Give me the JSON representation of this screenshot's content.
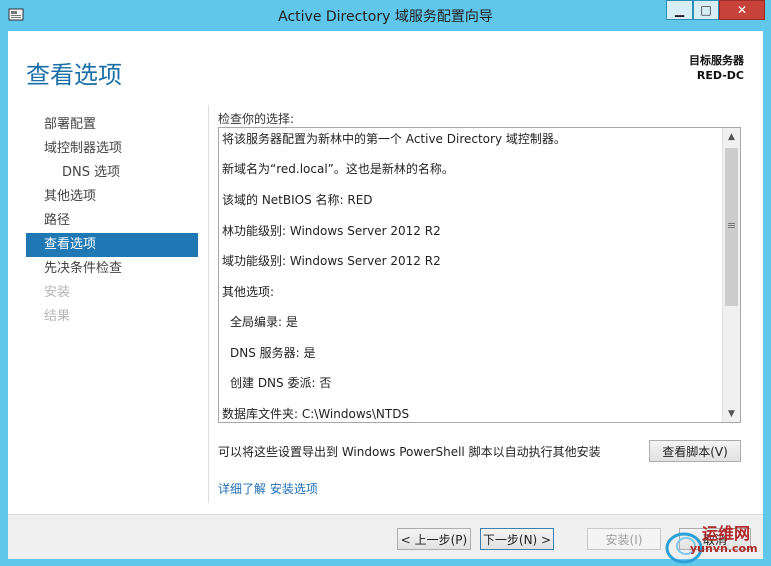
{
  "window": {
    "title": "Active Directory 域服务配置向导",
    "min_glyph": "▁",
    "max_glyph": "□",
    "close_glyph": "✕"
  },
  "header": {
    "page_title": "查看选项",
    "target_label": "目标服务器",
    "target_name": "RED-DC"
  },
  "nav": {
    "items": [
      {
        "label": "部署配置",
        "state": "normal"
      },
      {
        "label": "域控制器选项",
        "state": "normal"
      },
      {
        "label": "DNS 选项",
        "state": "sub"
      },
      {
        "label": "其他选项",
        "state": "normal"
      },
      {
        "label": "路径",
        "state": "normal"
      },
      {
        "label": "查看选项",
        "state": "active"
      },
      {
        "label": "先决条件检查",
        "state": "normal"
      },
      {
        "label": "安装",
        "state": "disabled"
      },
      {
        "label": "结果",
        "state": "disabled"
      }
    ]
  },
  "review": {
    "label": "检查你的选择:",
    "lines": [
      "将该服务器配置为新林中的第一个 Active Directory 域控制器。",
      "新域名为“red.local”。这也是新林的名称。",
      "该域的 NetBIOS 名称: RED",
      "林功能级别: Windows Server 2012 R2",
      "域功能级别: Windows Server 2012 R2",
      "其他选项:",
      "全局编录: 是",
      "DNS 服务器: 是",
      "创建 DNS 委派: 否",
      "数据库文件夹: C:\\Windows\\NTDS"
    ]
  },
  "export": {
    "text": "可以将这些设置导出到 Windows PowerShell 脚本以自动执行其他安装",
    "button": "查看脚本(V)"
  },
  "more_link": "详细了解 安装选项",
  "footer": {
    "prev": "< 上一步(P)",
    "next": "下一步(N) >",
    "install": "安装(I)",
    "cancel": "取消"
  },
  "watermark": {
    "name": "运维网",
    "url": "yunvn.com"
  },
  "colors": {
    "accent": "#1f78b4",
    "title_bar": "#60c6ea",
    "page_title": "#1a6fa8",
    "close": "#c7433a",
    "link": "#1f6fb5"
  }
}
